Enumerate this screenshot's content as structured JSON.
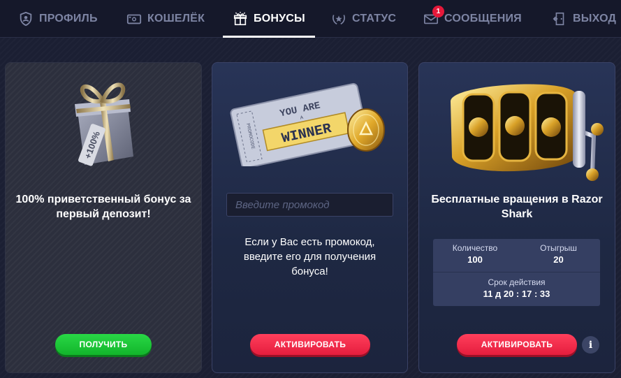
{
  "nav": {
    "items": [
      {
        "label": "ПРОФИЛЬ",
        "icon": "shield-user-icon"
      },
      {
        "label": "КОШЕЛЁК",
        "icon": "wallet-icon"
      },
      {
        "label": "БОНУСЫ",
        "icon": "gift-icon",
        "active": true
      },
      {
        "label": "СТАТУС",
        "icon": "laurel-star-icon"
      },
      {
        "label": "СООБЩЕНИЯ",
        "icon": "envelope-icon",
        "badge": "1"
      },
      {
        "label": "ВЫХОД",
        "icon": "exit-door-icon"
      }
    ]
  },
  "cards": {
    "welcome": {
      "art": "gift-box-illustration",
      "tag_text": "+100%",
      "title": "100% приветственный бонус за первый депозит!",
      "button": "ПОЛУЧИТЬ"
    },
    "promo": {
      "art": "winner-ticket-illustration",
      "ticket_top": "YOU ARE",
      "ticket_a": "A",
      "ticket_main": "WINNER",
      "ticket_side": "PROMOCODE",
      "input_placeholder": "Введите промокод",
      "text": "Если у Вас есть промокод, введите его для получения бонуса!",
      "button": "АКТИВИРОВАТЬ"
    },
    "spins": {
      "art": "slot-machine-illustration",
      "title": "Бесплатные вращения в Razor Shark",
      "quantity_label": "Количество",
      "quantity_value": "100",
      "wager_label": "Отыгрыш",
      "wager_value": "20",
      "validity_label": "Срок действия",
      "validity_value": "11 д 20 : 17 : 33",
      "button": "АКТИВИРОВАТЬ",
      "info": "i"
    }
  },
  "colors": {
    "green": "#1cc637",
    "red": "#f02a49",
    "nav_bg": "#15182a",
    "badge": "#e5183a"
  }
}
